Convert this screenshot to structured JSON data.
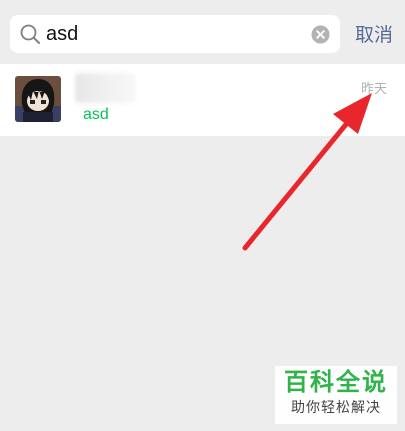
{
  "search": {
    "value": "asd",
    "cancel_label": "取消"
  },
  "results": [
    {
      "match_text": "asd",
      "time": "昨天"
    }
  ],
  "watermark": {
    "title": "百科全说",
    "subtitle": "助你轻松解决"
  },
  "colors": {
    "background": "#ededed",
    "link_blue": "#576b95",
    "match_green": "#07c160",
    "annotation_red": "#e8262b",
    "watermark_green": "#2fb34a"
  },
  "icons": [
    "search-icon",
    "clear-icon",
    "avatar",
    "annotation-arrow"
  ]
}
